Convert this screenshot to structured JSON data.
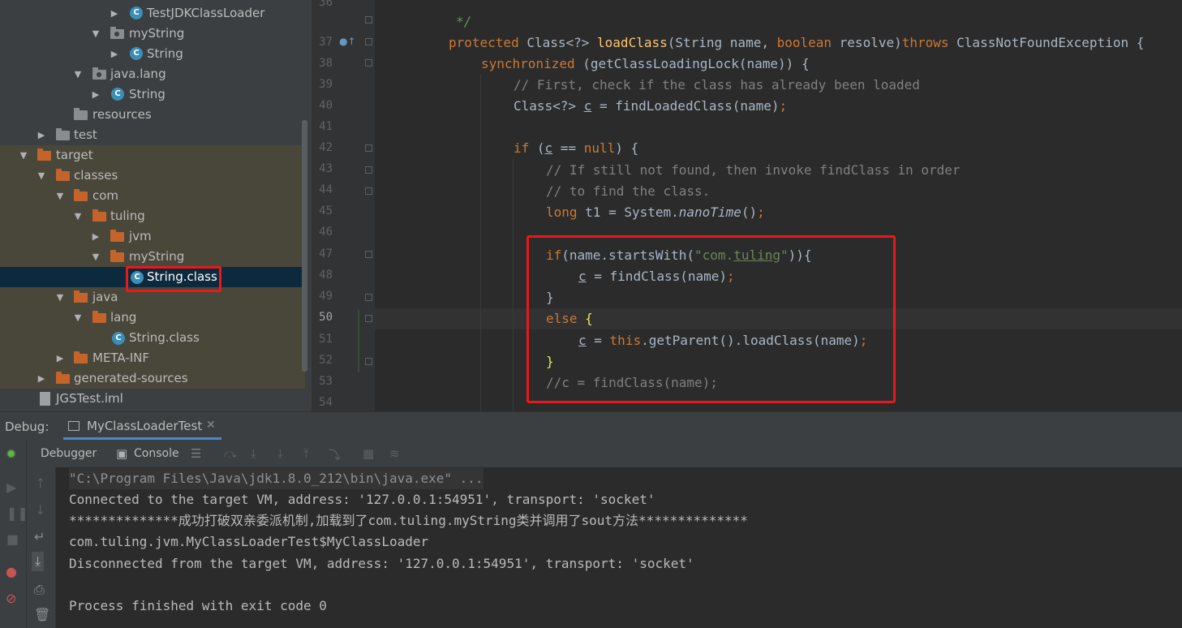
{
  "project_tree": {
    "rows": [
      {
        "label": "TestJDKClassLoader",
        "icon": "class-icon",
        "arrow": "▶"
      },
      {
        "label": "myString",
        "icon": "package-icon",
        "arrow": "▼"
      },
      {
        "label": "String",
        "icon": "class-icon",
        "arrow": "▶"
      },
      {
        "label": "java.lang",
        "icon": "package-icon",
        "arrow": "▼"
      },
      {
        "label": "String",
        "icon": "class-icon",
        "arrow": "▶"
      },
      {
        "label": "resources",
        "icon": "folder-icon",
        "arrow": ""
      },
      {
        "label": "test",
        "icon": "folder-icon",
        "arrow": "▶"
      },
      {
        "label": "target",
        "icon": "folder-icon",
        "arrow": "▼"
      },
      {
        "label": "classes",
        "icon": "folder-icon",
        "arrow": "▼"
      },
      {
        "label": "com",
        "icon": "folder-icon",
        "arrow": "▼"
      },
      {
        "label": "tuling",
        "icon": "folder-icon",
        "arrow": "▼"
      },
      {
        "label": "jvm",
        "icon": "folder-icon",
        "arrow": "▶"
      },
      {
        "label": "myString",
        "icon": "folder-icon",
        "arrow": "▼"
      },
      {
        "label": "String.class",
        "icon": "class-file-icon",
        "arrow": ""
      },
      {
        "label": "java",
        "icon": "folder-icon",
        "arrow": "▼"
      },
      {
        "label": "lang",
        "icon": "folder-icon",
        "arrow": "▼"
      },
      {
        "label": "String.class",
        "icon": "class-file-icon",
        "arrow": ""
      },
      {
        "label": "META-INF",
        "icon": "folder-icon",
        "arrow": "▶"
      },
      {
        "label": "generated-sources",
        "icon": "folder-icon",
        "arrow": "▶"
      },
      {
        "label": "JGSTest.iml",
        "icon": "file-icon",
        "arrow": ""
      }
    ],
    "class_glyph": "C"
  },
  "editor": {
    "line_numbers": [
      "36",
      "37",
      "38",
      "39",
      "40",
      "41",
      "42",
      "43",
      "44",
      "45",
      "46",
      "47",
      "48",
      "49",
      "50",
      "51",
      "52",
      "53",
      "54"
    ],
    "code": {
      "l36_doc": "*/",
      "l37_kw1": "protected",
      "l37_t1": " Class<?> ",
      "l37_fn": "loadClass",
      "l37_t2": "(String name, ",
      "l37_kw2": "boolean",
      "l37_t3": " resolve)",
      "l37_kw3": "throws",
      "l37_t4": " ClassNotFoundException {",
      "l38_kw": "synchronized",
      "l38_t": " (getClassLoadingLock(name)) {",
      "l39_cm": "// First, check if the class has already been loaded",
      "l40_t1": "Class<?> ",
      "l40_var": "c",
      "l40_t2": " = findLoadedClass(name)",
      "l40_semi": ";",
      "l42_kw1": "if",
      "l42_t1": " (",
      "l42_var": "c",
      "l42_t2": " == ",
      "l42_kw2": "null",
      "l42_t3": ") {",
      "l43_cm": "// If still not found, then invoke findClass in order",
      "l44_cm": "// to find the class.",
      "l45_kw": "long",
      "l45_t1": " t1 = System.",
      "l45_it": "nanoTime",
      "l45_t2": "()",
      "l45_semi": ";",
      "l47_kw": "if",
      "l47_t1": "(name.startsWith(",
      "l47_str1": "\"com.",
      "l47_str2": "tuling",
      "l47_str3": "\"",
      "l47_t2": ")){",
      "l48_var": "c",
      "l48_t": " = findClass(name)",
      "l48_semi": ";",
      "l49_t": "}",
      "l50_kw": "else",
      "l50_brace": "{",
      "l51_var": "c",
      "l51_t1": " = ",
      "l51_kw": "this",
      "l51_t2": ".getParent().loadClass(name)",
      "l51_semi": ";",
      "l52_brace": "}",
      "l53_cm": "//c = findClass(name);"
    }
  },
  "debug": {
    "label": "Debug:",
    "tab_label": "MyClassLoaderTest",
    "tab_close": "✕",
    "toolbar": {
      "debugger_label": "Debugger",
      "console_label": "Console"
    },
    "console_lines": [
      "\"C:\\Program Files\\Java\\jdk1.8.0_212\\bin\\java.exe\" ...",
      "Connected to the target VM, address: '127.0.0.1:54951', transport: 'socket'",
      "**************成功打破双亲委派机制,加载到了com.tuling.myString类并调用了sout方法**************",
      "com.tuling.jvm.MyClassLoaderTest$MyClassLoader",
      "Disconnected from the target VM, address: '127.0.0.1:54951', transport: 'socket'",
      "",
      "Process finished with exit code 0"
    ]
  },
  "colors": {
    "keyword": "#cc7832",
    "string": "#6a8759",
    "comment": "#808080",
    "function": "#ffc66d",
    "highlight_box": "#e8191b",
    "selection": "#0d293e"
  }
}
